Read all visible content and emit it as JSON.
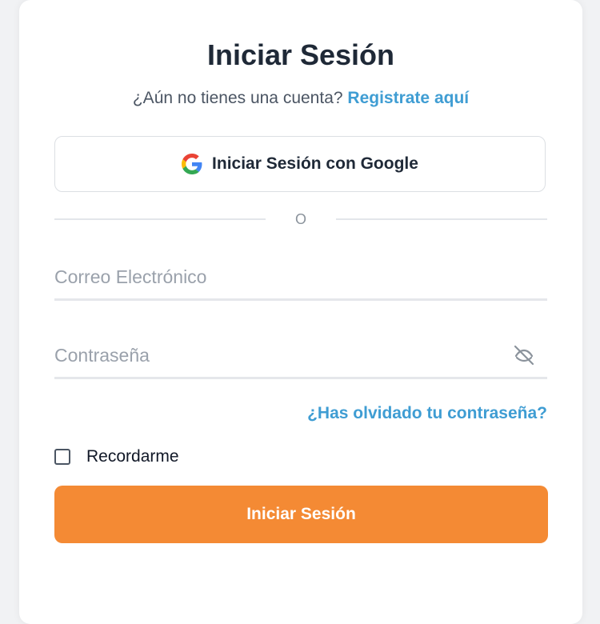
{
  "login": {
    "title": "Iniciar Sesión",
    "subtitle_prefix": "¿Aún no tienes una cuenta?",
    "register_link": "Registrate aquí",
    "google_button": "Iniciar Sesión con Google",
    "divider_text": "O",
    "email_placeholder": "Correo Electrónico",
    "email_value": "",
    "password_placeholder": "Contraseña",
    "password_value": "",
    "password_toggle_icon": "eye-off-icon",
    "forgot_link": "¿Has olvidado tu contraseña?",
    "remember_label": "Recordarme",
    "remember_checked": false,
    "submit_button": "Iniciar Sesión"
  },
  "colors": {
    "accent_orange": "#f48a34",
    "link_blue": "#3f9dd3",
    "title_dark": "#1f2937",
    "placeholder_gray": "#9aa1ab"
  }
}
